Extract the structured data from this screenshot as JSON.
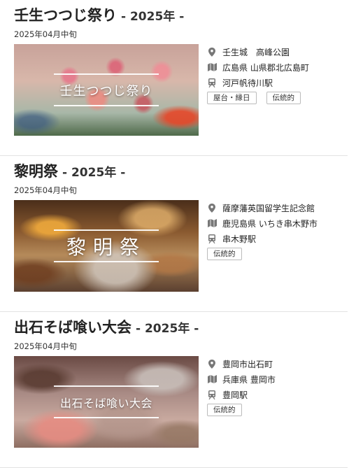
{
  "events": [
    {
      "title": "壬生つつじ祭り",
      "year": "- 2025年 -",
      "date": "2025年04月中旬",
      "image_caption": "壬生つつじ祭り",
      "venue": "壬生城　高峰公園",
      "address": "広島県 山県郡北広島町",
      "station": "河戸帆待川駅",
      "tags": [
        "屋台・縁日",
        "伝統的"
      ]
    },
    {
      "title": "黎明祭",
      "year": "- 2025年 -",
      "date": "2025年04月中旬",
      "image_caption": "黎明祭",
      "venue": "薩摩藩英国留学生記念館",
      "address": "鹿児島県 いちき串木野市",
      "station": "串木野駅",
      "tags": [
        "伝統的"
      ]
    },
    {
      "title": "出石そば喰い大会",
      "year": "- 2025年 -",
      "date": "2025年04月中旬",
      "image_caption": "出石そば喰い大会",
      "venue": "豊岡市出石町",
      "address": "兵庫県 豊岡市",
      "station": "豊岡駅",
      "tags": [
        "伝統的"
      ]
    }
  ],
  "icons": {
    "venue": "map-pin-icon",
    "address": "map-icon",
    "station": "train-icon"
  },
  "colors": {
    "icon": "#777777",
    "divider": "#e2e2e2"
  }
}
